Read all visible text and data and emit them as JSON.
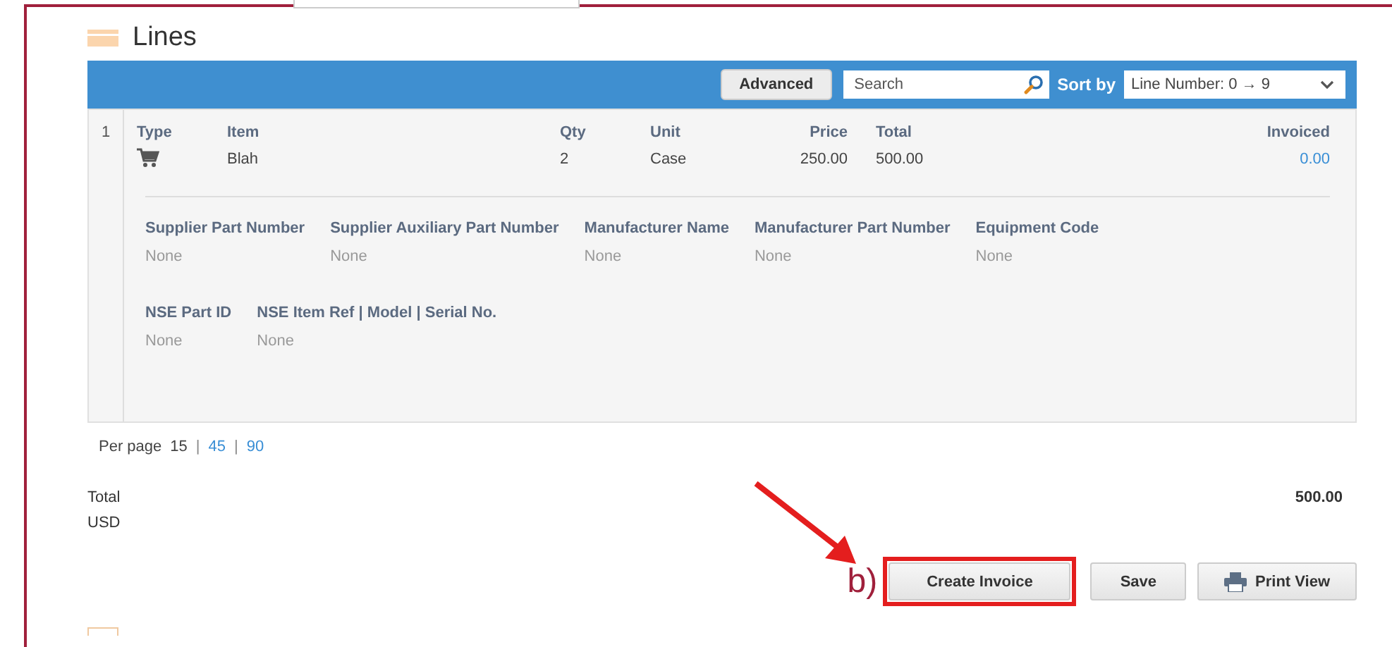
{
  "section": {
    "title": "Lines"
  },
  "toolbar": {
    "advanced_button": "Advanced",
    "search": {
      "placeholder": "Search"
    },
    "sort_label": "Sort by",
    "sort_value": "Line Number: 0 → 9"
  },
  "lines": [
    {
      "number": "1",
      "columns": [
        {
          "label": "Type",
          "kind": "icon"
        },
        {
          "label": "Item",
          "kind": "text",
          "value": "Blah"
        },
        {
          "label": "Qty",
          "kind": "text",
          "value": "2"
        },
        {
          "label": "Unit",
          "kind": "text",
          "value": "Case"
        },
        {
          "label": "Price",
          "kind": "number",
          "value": "250.00"
        },
        {
          "label": "Total",
          "kind": "number",
          "value": "500.00"
        },
        {
          "label": "Invoiced",
          "kind": "link",
          "value": "0.00"
        }
      ],
      "details": [
        [
          {
            "label": "Supplier Part Number",
            "value": "None"
          },
          {
            "label": "Supplier Auxiliary Part Number",
            "value": "None"
          },
          {
            "label": "Manufacturer Name",
            "value": "None"
          },
          {
            "label": "Manufacturer Part Number",
            "value": "None"
          },
          {
            "label": "Equipment Code",
            "value": "None"
          }
        ],
        [
          {
            "label": "NSE Part ID",
            "value": "None"
          },
          {
            "label": "NSE Item Ref | Model | Serial No.",
            "value": "None"
          }
        ]
      ]
    }
  ],
  "pagination": {
    "label": "Per page",
    "separator": "|",
    "options": [
      {
        "text": "15",
        "selected": true
      },
      {
        "text": "45",
        "selected": false
      },
      {
        "text": "90",
        "selected": false
      }
    ]
  },
  "total": {
    "label": "Total",
    "currency": "USD",
    "amount": "500.00"
  },
  "buttons": [
    {
      "label": "Create Invoice",
      "kind": "plain",
      "highlighted": true
    },
    {
      "label": "Save",
      "kind": "plain",
      "highlighted": false
    },
    {
      "label": "Print View",
      "kind": "print",
      "highlighted": false
    }
  ],
  "annotation": {
    "label": "b)"
  }
}
